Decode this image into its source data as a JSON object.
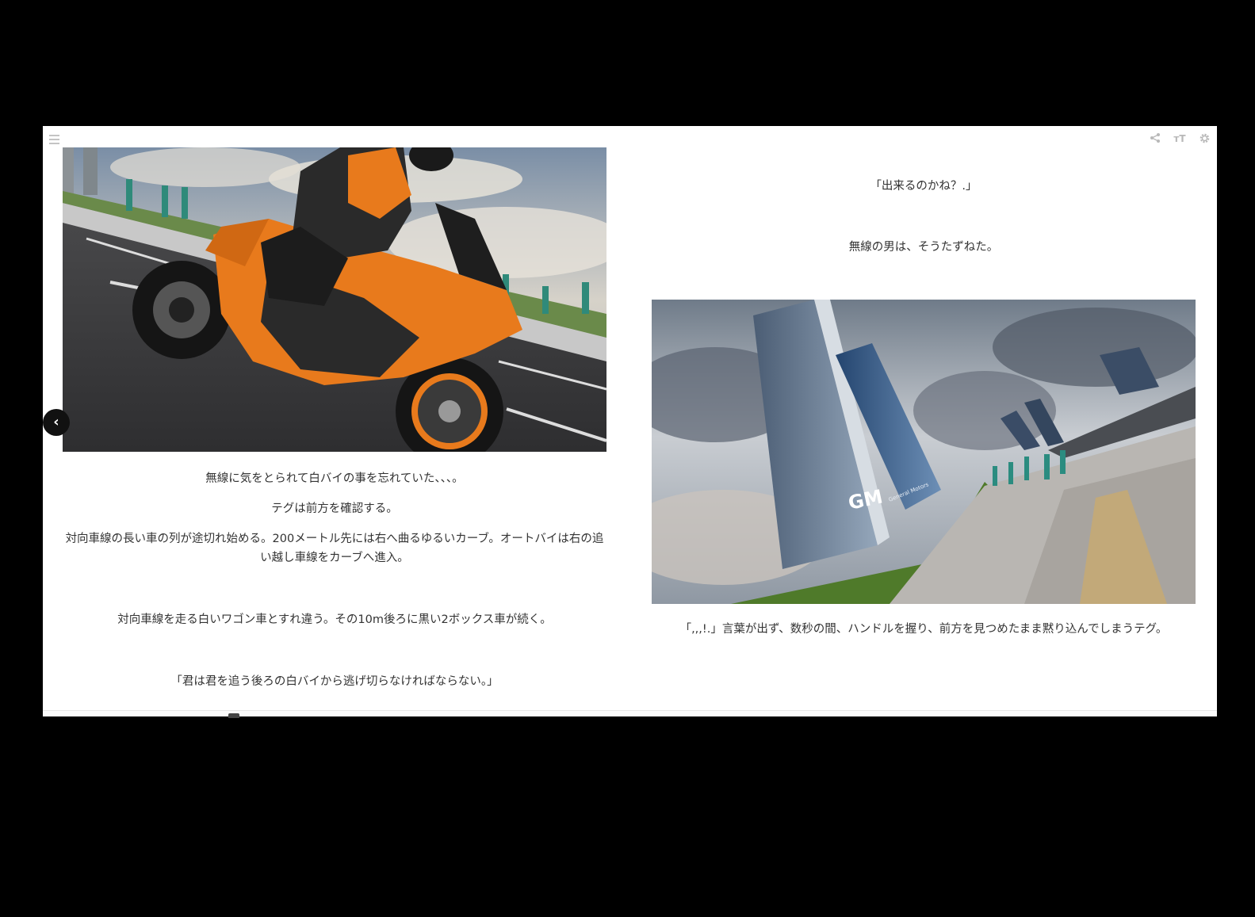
{
  "toolbar": {
    "menu_icon": "menu-icon",
    "share_icon": "share-icon",
    "font_size_label": "тT",
    "settings_icon": "gear-icon"
  },
  "navigation": {
    "prev_glyph": "‹"
  },
  "left_page": {
    "image": "motorcycle-rider-illustration",
    "paragraphs": [
      "無線に気をとられて白バイの事を忘れていた、、、。",
      "テグは前方を確認する。",
      "対向車線の長い車の列が途切れ始める。200メートル先には右へ曲るゆるいカーブ。オートバイは右の追い越し車線をカーブへ進入。",
      "対向車線を走る白いワゴン車とすれ違う。その10m後ろに黒い2ボックス車が続く。",
      "「君は君を追う後ろの白バイから逃げ切らなければならない。」"
    ]
  },
  "right_page": {
    "paragraphs_top": [
      "「出来るのかね？.」",
      "無線の男は、そうたずねた。"
    ],
    "image": "gm-tower-street-illustration",
    "image_sign": "GM",
    "image_sign_sub": "General Motors",
    "paragraph_bottom": "「,,,!.」言葉が出ず、数秒の間、ハンドルを握り、前方を見つめたまま黙り込んでしまうテグ。"
  },
  "colors": {
    "background": "#000000",
    "page": "#ffffff",
    "text": "#333333",
    "bike_orange": "#e87a1c"
  }
}
